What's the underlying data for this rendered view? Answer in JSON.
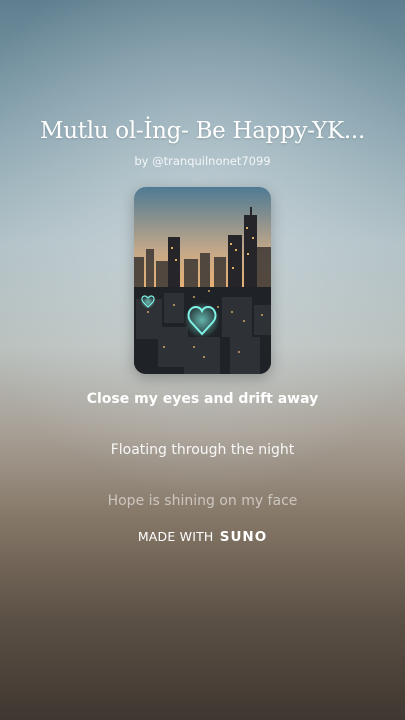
{
  "song": {
    "title": "Mutlu ol-İng- Be Happy-YK...",
    "artist_line": "by @tranquilnonet7099"
  },
  "cover_art": {
    "icon": "city-heart-artwork"
  },
  "lyrics": {
    "current": "Close my eyes and drift away",
    "next": "Floating through the night",
    "later": "Hope is shining on my face"
  },
  "branding": {
    "prefix": "MADE WITH",
    "brand": "SUNO"
  },
  "colors": {
    "background_top": "#5f7f8f",
    "background_bottom": "#3f3730",
    "neon_heart": "#7ff3e6"
  }
}
